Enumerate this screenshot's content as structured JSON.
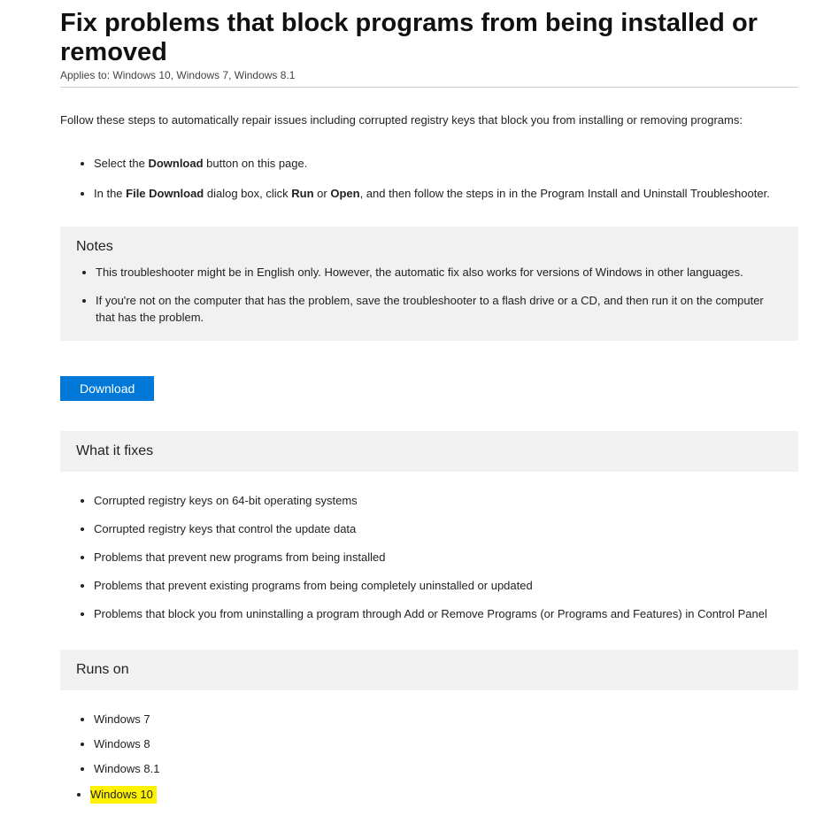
{
  "header": {
    "title": "Fix problems that block programs from being installed or removed",
    "applies_to": "Applies to: Windows 10, Windows 7, Windows 8.1"
  },
  "intro": "Follow these steps to automatically repair issues including corrupted registry keys that block you from installing or removing programs:",
  "steps": {
    "s1_pre": "Select the ",
    "s1_bold": "Download",
    "s1_post": " button on this page.",
    "s2_pre": "In the ",
    "s2_b1": "File Download",
    "s2_mid": " dialog box, click ",
    "s2_b2": "Run",
    "s2_or": " or ",
    "s2_b3": "Open",
    "s2_post": ", and then follow the steps in in the Program Install and Uninstall Troubleshooter."
  },
  "notes": {
    "title": "Notes",
    "items": [
      "This troubleshooter might be in English only. However, the automatic fix also works for versions of Windows in other languages.",
      "If you're not on the computer that has the problem, save the troubleshooter to a flash drive or a CD, and then run it on the computer that has the problem."
    ]
  },
  "download_label": "Download",
  "what_it_fixes": {
    "title": "What it fixes",
    "items": [
      "Corrupted registry keys on 64-bit operating systems",
      "Corrupted registry keys that control the update data",
      "Problems that prevent new programs from being installed",
      "Problems that prevent existing programs from being completely uninstalled or updated",
      "Problems that block you from uninstalling a program through Add or Remove Programs (or Programs and Features) in Control Panel"
    ]
  },
  "runs_on": {
    "title": "Runs on",
    "items": [
      "Windows 7",
      "Windows 8",
      "Windows 8.1",
      "Windows 10"
    ],
    "highlight_index": 3
  }
}
